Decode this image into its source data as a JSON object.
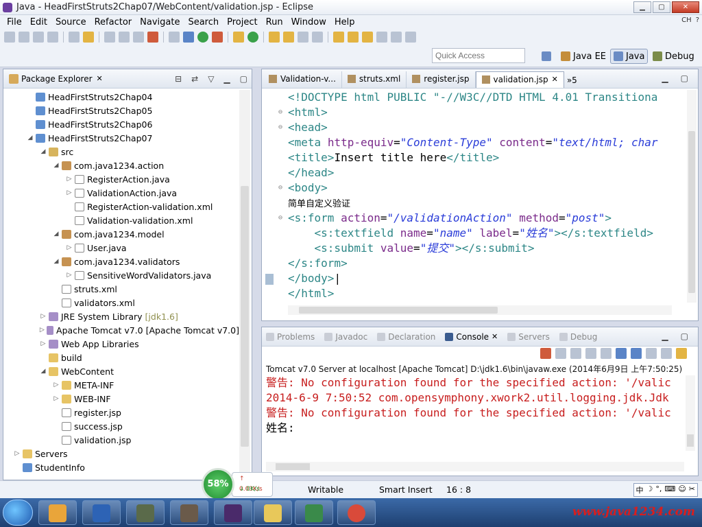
{
  "window": {
    "title": "Java - HeadFirstStruts2Chap07/WebContent/validation.jsp - Eclipse",
    "ime_indicator": "CH"
  },
  "menu": [
    "File",
    "Edit",
    "Source",
    "Refactor",
    "Navigate",
    "Search",
    "Project",
    "Run",
    "Window",
    "Help"
  ],
  "quick_access": {
    "placeholder": "Quick Access"
  },
  "perspectives": {
    "javaee": "Java EE",
    "java": "Java",
    "debug": "Debug"
  },
  "package_explorer": {
    "title": "Package Explorer",
    "items": [
      {
        "indent": 1,
        "arrow": "",
        "icon": "proj",
        "label": "HeadFirstStruts2Chap04",
        "note": ""
      },
      {
        "indent": 1,
        "arrow": "",
        "icon": "proj",
        "label": "HeadFirstStruts2Chap05",
        "note": ""
      },
      {
        "indent": 1,
        "arrow": "",
        "icon": "proj",
        "label": "HeadFirstStruts2Chap06",
        "note": ""
      },
      {
        "indent": 1,
        "arrow": "◢",
        "icon": "proj",
        "label": "HeadFirstStruts2Chap07",
        "note": ""
      },
      {
        "indent": 2,
        "arrow": "◢",
        "icon": "src",
        "label": "src",
        "note": ""
      },
      {
        "indent": 3,
        "arrow": "◢",
        "icon": "pkg",
        "label": "com.java1234.action",
        "note": ""
      },
      {
        "indent": 4,
        "arrow": "▷",
        "icon": "java",
        "label": "RegisterAction.java",
        "note": ""
      },
      {
        "indent": 4,
        "arrow": "▷",
        "icon": "java",
        "label": "ValidationAction.java",
        "note": ""
      },
      {
        "indent": 4,
        "arrow": "",
        "icon": "xml",
        "label": "RegisterAction-validation.xml",
        "note": ""
      },
      {
        "indent": 4,
        "arrow": "",
        "icon": "xml",
        "label": "Validation-validation.xml",
        "note": ""
      },
      {
        "indent": 3,
        "arrow": "◢",
        "icon": "pkg",
        "label": "com.java1234.model",
        "note": ""
      },
      {
        "indent": 4,
        "arrow": "▷",
        "icon": "java",
        "label": "User.java",
        "note": ""
      },
      {
        "indent": 3,
        "arrow": "◢",
        "icon": "pkg",
        "label": "com.java1234.validators",
        "note": ""
      },
      {
        "indent": 4,
        "arrow": "▷",
        "icon": "java",
        "label": "SensitiveWordValidators.java",
        "note": ""
      },
      {
        "indent": 3,
        "arrow": "",
        "icon": "xml",
        "label": "struts.xml",
        "note": ""
      },
      {
        "indent": 3,
        "arrow": "",
        "icon": "xml",
        "label": "validators.xml",
        "note": ""
      },
      {
        "indent": 2,
        "arrow": "▷",
        "icon": "lib",
        "label": "JRE System Library",
        "note": "[jdk1.6]"
      },
      {
        "indent": 2,
        "arrow": "▷",
        "icon": "lib",
        "label": "Apache Tomcat v7.0 [Apache Tomcat v7.0]",
        "note": ""
      },
      {
        "indent": 2,
        "arrow": "▷",
        "icon": "lib",
        "label": "Web App Libraries",
        "note": ""
      },
      {
        "indent": 2,
        "arrow": "",
        "icon": "folder",
        "label": "build",
        "note": ""
      },
      {
        "indent": 2,
        "arrow": "◢",
        "icon": "folder",
        "label": "WebContent",
        "note": ""
      },
      {
        "indent": 3,
        "arrow": "▷",
        "icon": "folder",
        "label": "META-INF",
        "note": ""
      },
      {
        "indent": 3,
        "arrow": "▷",
        "icon": "folder",
        "label": "WEB-INF",
        "note": ""
      },
      {
        "indent": 3,
        "arrow": "",
        "icon": "xml",
        "label": "register.jsp",
        "note": ""
      },
      {
        "indent": 3,
        "arrow": "",
        "icon": "xml",
        "label": "success.jsp",
        "note": ""
      },
      {
        "indent": 3,
        "arrow": "",
        "icon": "xml",
        "label": "validation.jsp",
        "note": ""
      },
      {
        "indent": 0,
        "arrow": "▷",
        "icon": "folder",
        "label": "Servers",
        "note": ""
      },
      {
        "indent": 0,
        "arrow": "",
        "icon": "proj",
        "label": "StudentInfo",
        "note": ""
      }
    ]
  },
  "editor": {
    "tabs": [
      {
        "label": "Validation-v...",
        "active": false
      },
      {
        "label": "struts.xml",
        "active": false
      },
      {
        "label": "register.jsp",
        "active": false
      },
      {
        "label": "validation.jsp",
        "active": true
      }
    ],
    "overflow_label": "»5",
    "lines": [
      {
        "fold": "",
        "html": "<span class=\"tag\">&lt;!DOCTYPE html PUBLIC \"-//W3C//DTD HTML 4.01 Transitiona</span>"
      },
      {
        "fold": "⊖",
        "html": "<span class=\"tag\">&lt;html&gt;</span>"
      },
      {
        "fold": "⊖",
        "html": "<span class=\"tag\">&lt;head&gt;</span>"
      },
      {
        "fold": "",
        "html": "<span class=\"tag\">&lt;meta</span> <span class=\"attr\">http-equiv</span>=<span class=\"val\">\"Content-Type\"</span> <span class=\"attr\">content</span>=<span class=\"val\">\"text/html; char</span>"
      },
      {
        "fold": "",
        "html": "<span class=\"tag\">&lt;title&gt;</span>Insert title here<span class=\"tag\">&lt;/title&gt;</span>"
      },
      {
        "fold": "",
        "html": "<span class=\"tag\">&lt;/head&gt;</span>"
      },
      {
        "fold": "⊖",
        "html": "<span class=\"tag\">&lt;body&gt;</span>"
      },
      {
        "fold": "",
        "html": "<span style=\"font-family:'DejaVu Sans',sans-serif;font-size:13px\">简单自定义验证</span>"
      },
      {
        "fold": "⊖",
        "html": "<span class=\"tag\">&lt;s:form</span> <span class=\"attr\">action</span>=<span class=\"val\">\"/validationAction\"</span> <span class=\"attr\">method</span>=<span class=\"val\">\"post\"</span><span class=\"tag\">&gt;</span>"
      },
      {
        "fold": "",
        "html": "    <span class=\"tag\">&lt;s:textfield</span> <span class=\"attr\">name</span>=<span class=\"val\">\"name\"</span> <span class=\"attr\">label</span>=<span class=\"val\">\"姓名\"</span><span class=\"tag\">&gt;&lt;/s:textfield&gt;</span>"
      },
      {
        "fold": "",
        "html": "    <span class=\"tag\">&lt;s:submit</span> <span class=\"attr\">value</span>=<span class=\"val\">\"提交\"</span><span class=\"tag\">&gt;&lt;/s:submit&gt;</span>"
      },
      {
        "fold": "",
        "html": "<span class=\"tag\">&lt;/s:form&gt;</span>"
      },
      {
        "fold": "",
        "html": "<span class=\"tag\">&lt;/body&gt;</span>|",
        "mark": true
      },
      {
        "fold": "",
        "html": "<span class=\"tag\">&lt;/html&gt;</span>"
      }
    ]
  },
  "console": {
    "tabs": [
      {
        "label": "Problems",
        "active": false
      },
      {
        "label": "Javadoc",
        "active": false
      },
      {
        "label": "Declaration",
        "active": false
      },
      {
        "label": "Console",
        "active": true
      },
      {
        "label": "Servers",
        "active": false
      },
      {
        "label": "Debug",
        "active": false
      }
    ],
    "server_line": "Tomcat v7.0 Server at localhost [Apache Tomcat] D:\\jdk1.6\\bin\\javaw.exe (2014年6月9日 上午7:50:25)",
    "lines": [
      {
        "text": "警告: No configuration found for the specified action: '/valic",
        "err": true
      },
      {
        "text": "2014-6-9 7:50:52 com.opensymphony.xwork2.util.logging.jdk.Jdk",
        "err": true
      },
      {
        "text": "警告: No configuration found for the specified action: '/valic",
        "err": true
      },
      {
        "text": "姓名:",
        "err": false
      }
    ]
  },
  "status": {
    "writable": "Writable",
    "insert_mode": "Smart Insert",
    "position": "16 : 8"
  },
  "network": {
    "percent": "58%",
    "upload": "0.03K/s",
    "download": "0K/s"
  },
  "ime": [
    "中",
    "☽",
    "°,",
    "⌨",
    "☺",
    "✂"
  ],
  "taskbar": {
    "watermark": "www.java1234.com"
  },
  "colors": {
    "error_text": "#c71d1d",
    "tag": "#2c8686",
    "attr": "#7a2a8a",
    "value": "#2a3cd8"
  }
}
